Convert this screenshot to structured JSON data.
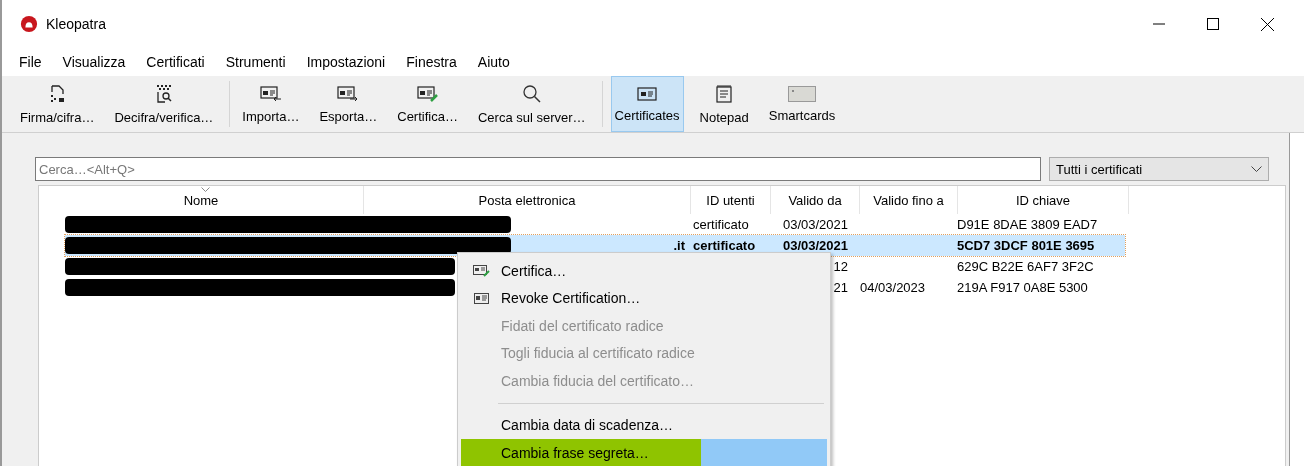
{
  "window": {
    "title": "Kleopatra"
  },
  "menu_bar": [
    "File",
    "Visualizza",
    "Certificati",
    "Strumenti",
    "Impostazioni",
    "Finestra",
    "Aiuto"
  ],
  "toolbar": [
    [
      {
        "label": "Firma/cifra…",
        "selected": false
      },
      {
        "label": "Decifra/verifica…",
        "selected": false
      }
    ],
    [
      {
        "label": "Importa…",
        "selected": false
      },
      {
        "label": "Esporta…",
        "selected": false
      },
      {
        "label": "Certifica…",
        "selected": false
      },
      {
        "label": "Cerca sul server…",
        "selected": false
      }
    ],
    [
      {
        "label": "Certificates",
        "selected": true
      },
      {
        "label": "Notepad",
        "selected": false
      },
      {
        "label": "Smartcards",
        "selected": false
      }
    ]
  ],
  "search": {
    "placeholder": "Cerca…<Alt+Q>"
  },
  "filter": {
    "value": "Tutti i certificati"
  },
  "table": {
    "columns": [
      "Nome",
      "Posta elettronica",
      "ID utenti",
      "Valido da",
      "Valido fino a",
      "ID chiave"
    ],
    "rows": [
      {
        "selected": false,
        "redacted": true,
        "email_tail": "",
        "id_utenti": "certificato",
        "valido_da": "03/03/2021",
        "valido_fino": "",
        "id_chiave": "D91E 8DAE 3809 EAD7"
      },
      {
        "selected": true,
        "redacted": true,
        "email_tail": ".it",
        "id_utenti": "certificato",
        "valido_da": "03/03/2021",
        "valido_fino": "",
        "id_chiave": "5CD7 3DCF 801E 3695"
      },
      {
        "selected": false,
        "redacted": true,
        "email_tail": "",
        "id_utenti": "",
        "valido_da": "12",
        "valido_fino": "",
        "id_chiave": "629C B22E 6AF7 3F2C"
      },
      {
        "selected": false,
        "redacted": true,
        "email_tail": "",
        "id_utenti": "",
        "valido_da": "21",
        "valido_fino": "04/03/2023",
        "id_chiave": "219A F917 0A8E 5300"
      }
    ]
  },
  "context_menu": [
    {
      "kind": "certify",
      "label": "Certifica…",
      "disabled": false,
      "selected": false,
      "marked": false
    },
    {
      "kind": "revoke",
      "label": "Revoke Certification…",
      "disabled": false,
      "selected": false,
      "marked": false
    },
    {
      "kind": "plain",
      "label": "Fidati del certificato radice",
      "disabled": true,
      "selected": false,
      "marked": false
    },
    {
      "kind": "plain",
      "label": "Togli fiducia al certificato radice",
      "disabled": true,
      "selected": false,
      "marked": false
    },
    {
      "kind": "plain",
      "label": "Cambia fiducia del certificato…",
      "disabled": true,
      "selected": false,
      "marked": false
    },
    {
      "kind": "separator"
    },
    {
      "kind": "plain",
      "label": "Cambia data di scadenza…",
      "disabled": false,
      "selected": false,
      "marked": false
    },
    {
      "kind": "plain",
      "label": "Cambia frase segreta…",
      "disabled": false,
      "selected": true,
      "marked": true
    }
  ]
}
